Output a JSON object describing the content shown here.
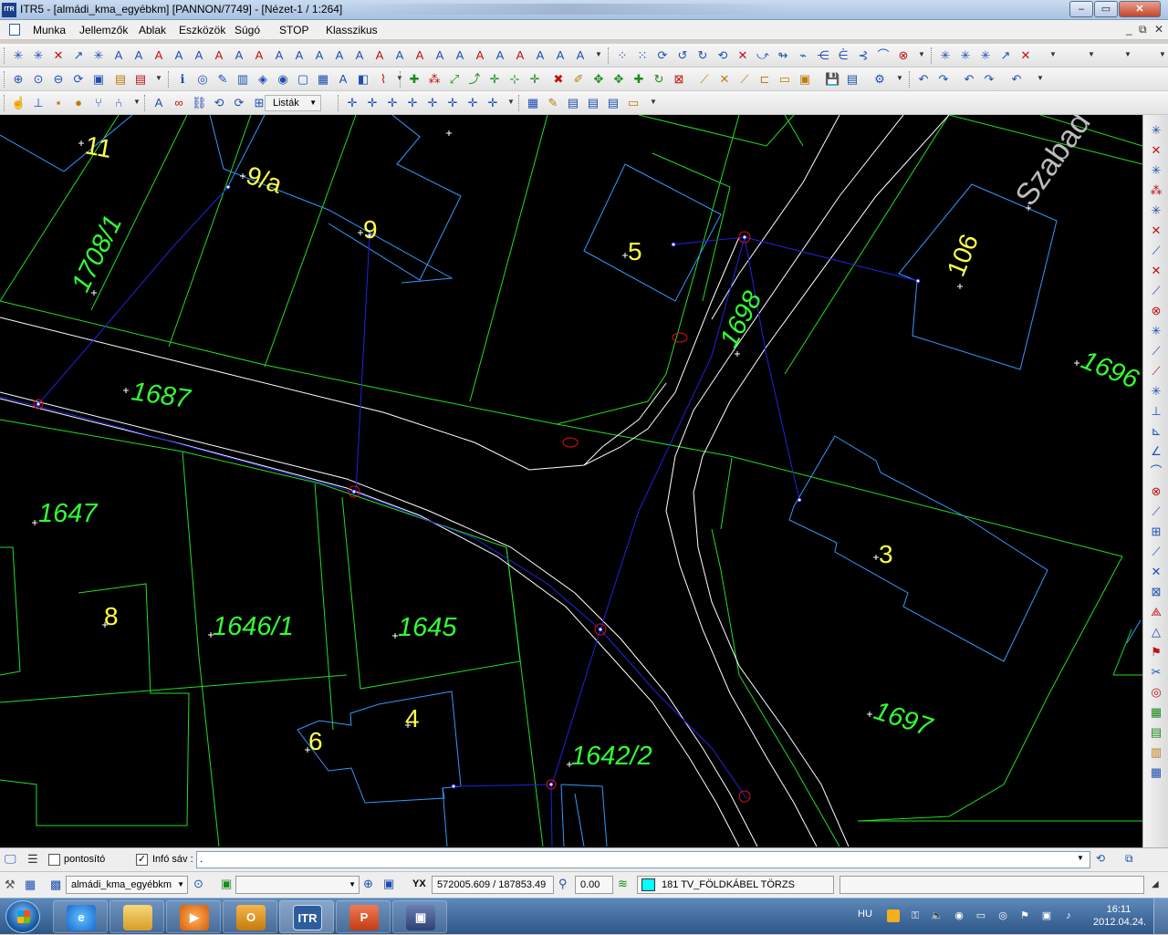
{
  "window": {
    "app_icon_text": "ITR",
    "title": "ITR5 - [almádi_kma_egyébkm] [PANNON/7749] - [Nézet-1 / 1:264]",
    "minimize": "–",
    "maximize": "▭",
    "close": "✕"
  },
  "menu": {
    "items": [
      "Munka",
      "Jellemzők",
      "Ablak",
      "Eszközök",
      "Súgó",
      "STOP",
      "Klasszikus"
    ],
    "mdi_controls": [
      "_",
      "⧉",
      "✕"
    ]
  },
  "toolbar3": {
    "lists_label": "Listák"
  },
  "map": {
    "street_label": "Szabad",
    "parcels": [
      "1708/1",
      "1687",
      "1647",
      "1646/1",
      "1645",
      "1698",
      "1696",
      "1697",
      "1642/2"
    ],
    "house_numbers": [
      "11",
      "9/a",
      "9",
      "5",
      "106",
      "8",
      "3",
      "6",
      "4"
    ],
    "colors": {
      "background": "#000000",
      "parcel_line": "#22dd22",
      "parcel_label": "#33ff33",
      "building_line": "#3399ff",
      "house_number": "#ffff44",
      "road_edge": "#ffffff",
      "cable": "#2222dd",
      "node": "#dd1111",
      "street_label": "#bbbbbb"
    }
  },
  "info_bar": {
    "checkbox_pontosito_label": "pontosító",
    "pontosito_checked": false,
    "checkbox_info_label": "Infó sáv :",
    "info_checked": true,
    "info_value": "."
  },
  "status_bar": {
    "project_name": "almádi_kma_egyébkm",
    "xy_label": "YX",
    "coordinates": "572005.609 / 187853.49",
    "angle": "0.00",
    "layer_color": "#00ffff",
    "layer_label": "181  TV_FÖLDKÁBEL TÖRZS"
  },
  "taskbar": {
    "language": "HU",
    "time": "16:11",
    "date": "2012.04.24.",
    "apps": [
      "Windows Explorer",
      "Internet Explorer",
      "Media Player",
      "Outlook",
      "ITR",
      "PowerPoint",
      "Save"
    ],
    "itr_button_text": "ITR"
  }
}
